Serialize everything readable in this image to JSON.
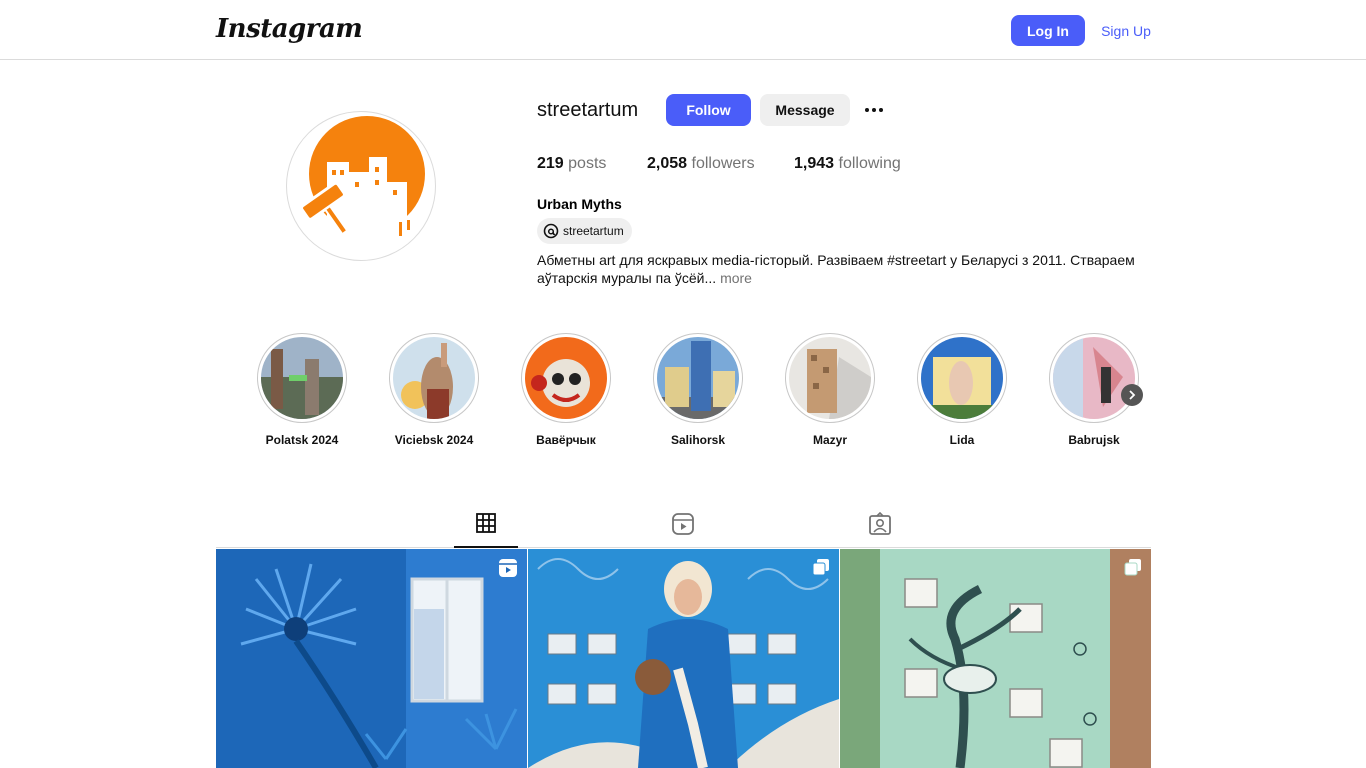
{
  "brand": {
    "logo_text": "Instagram"
  },
  "auth": {
    "login_label": "Log In",
    "signup_label": "Sign Up"
  },
  "profile": {
    "username": "streetartum",
    "follow_label": "Follow",
    "message_label": "Message",
    "stats": [
      {
        "value": "219",
        "label": "posts"
      },
      {
        "value": "2,058",
        "label": "followers"
      },
      {
        "value": "1,943",
        "label": "following"
      }
    ],
    "full_name": "Urban Myths",
    "threads_handle": "streetartum",
    "bio_text": "Абметны art для яскравых media-гісторый. Развіваем #streetart у Беларусі з 2011. Ствараем аўтарскія муралы па ўсёй...",
    "bio_more": "more"
  },
  "highlights": [
    {
      "label": "Polatsk 2024"
    },
    {
      "label": "Viciebsk 2024"
    },
    {
      "label": "Вавёрчык"
    },
    {
      "label": "Salihorsk"
    },
    {
      "label": "Mazyr"
    },
    {
      "label": "Lida"
    },
    {
      "label": "Babrujsk"
    }
  ],
  "tabs": [
    {
      "icon": "grid-icon",
      "active": true
    },
    {
      "icon": "reels-icon",
      "active": false
    },
    {
      "icon": "tagged-icon",
      "active": false
    }
  ],
  "posts": [
    {
      "type": "reel",
      "icon": "reel-badge-icon"
    },
    {
      "type": "carousel",
      "icon": "carousel-badge-icon"
    },
    {
      "type": "carousel",
      "icon": "carousel-badge-icon"
    }
  ],
  "colors": {
    "accent": "#4a5df9",
    "brand_orange": "#f5820d"
  }
}
